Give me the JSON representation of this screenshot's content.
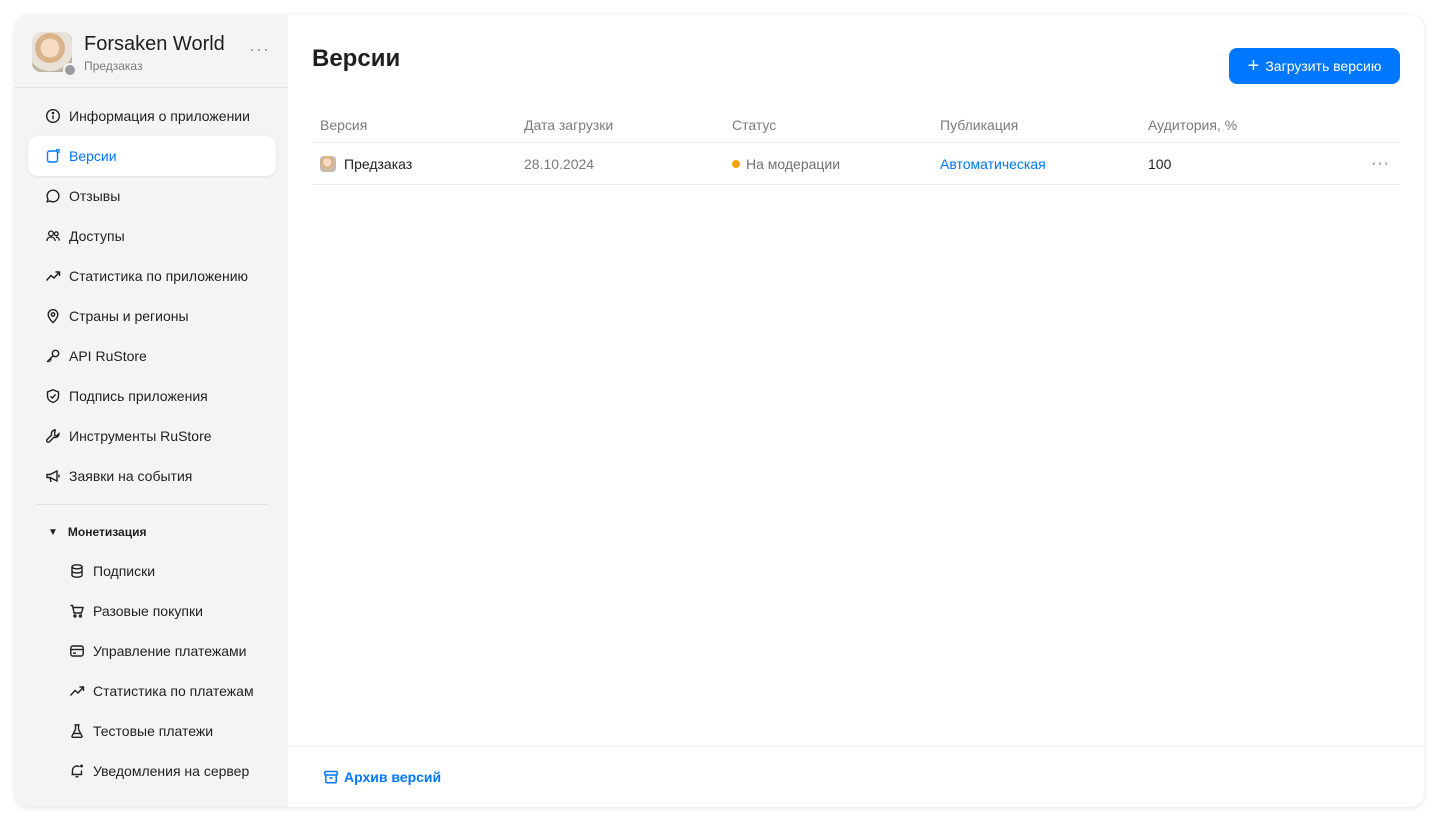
{
  "app": {
    "title": "Forsaken World",
    "subtitle": "Предзаказ",
    "more": "···"
  },
  "sidebar": {
    "items": [
      {
        "label": "Информация о приложении",
        "icon": "info-icon"
      },
      {
        "label": "Версии",
        "icon": "versions-icon",
        "active": true
      },
      {
        "label": "Отзывы",
        "icon": "comment-icon"
      },
      {
        "label": "Доступы",
        "icon": "users-icon"
      },
      {
        "label": "Статистика по приложению",
        "icon": "chart-icon"
      },
      {
        "label": "Страны и регионы",
        "icon": "location-icon"
      },
      {
        "label": "API RuStore",
        "icon": "key-icon"
      },
      {
        "label": "Подпись приложения",
        "icon": "shield-icon"
      },
      {
        "label": "Инструменты RuStore",
        "icon": "wrench-icon"
      },
      {
        "label": "Заявки на события",
        "icon": "megaphone-icon"
      }
    ],
    "section": {
      "label": "Монетизация",
      "caret": "▼"
    },
    "sub_items": [
      {
        "label": "Подписки",
        "icon": "database-icon"
      },
      {
        "label": "Разовые покупки",
        "icon": "cart-icon"
      },
      {
        "label": "Управление платежами",
        "icon": "card-icon"
      },
      {
        "label": "Статистика по платежам",
        "icon": "chart-icon"
      },
      {
        "label": "Тестовые платежи",
        "icon": "flask-icon"
      },
      {
        "label": "Уведомления на сервер",
        "icon": "bell-icon"
      }
    ]
  },
  "main": {
    "title": "Версии",
    "upload_button": {
      "plus": "+",
      "label": "Загрузить версию"
    },
    "table": {
      "headers": [
        "Версия",
        "Дата загрузки",
        "Статус",
        "Публикация",
        "Аудитория, %"
      ],
      "rows": [
        {
          "version": "Предзаказ",
          "date": "28.10.2024",
          "status": "На модерации",
          "publication": "Автоматическая",
          "audience": "100",
          "more": "···"
        }
      ]
    },
    "archive_link": "Архив версий"
  },
  "colors": {
    "accent": "#0077ff",
    "status_pending": "#f5a300",
    "sidebar_bg": "#f4f4f5"
  }
}
